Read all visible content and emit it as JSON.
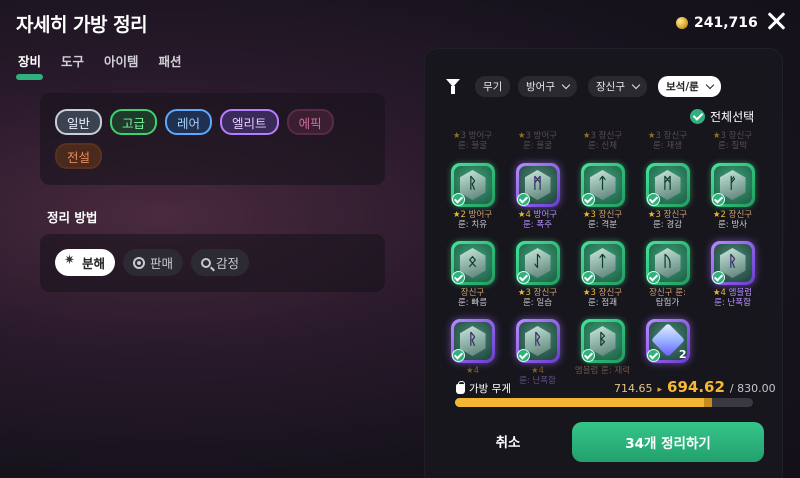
{
  "title": "자세히 가방 정리",
  "gold": "241,716",
  "tabs": [
    {
      "label": "장비",
      "active": true
    },
    {
      "label": "도구",
      "active": false
    },
    {
      "label": "아이템",
      "active": false
    },
    {
      "label": "패션",
      "active": false
    }
  ],
  "grades": {
    "normal": "일반",
    "high": "고급",
    "rare": "레어",
    "elite": "엘리트",
    "epic": "에픽",
    "legend": "전설"
  },
  "method": {
    "title": "정리 방법",
    "dismantle": "분해",
    "sell": "판매",
    "appraise": "감정"
  },
  "filters": {
    "weapon": "무기",
    "armor": "방어구",
    "accessory": "장신구",
    "gem": "보석/룬"
  },
  "select_all": "전체선택",
  "faded_items": [
    {
      "stars": "3",
      "line1": "방어구",
      "line2": "룬: 불굴"
    },
    {
      "stars": "3",
      "line1": "방어구",
      "line2": "룬: 불굴"
    },
    {
      "stars": "3",
      "line1": "장신구",
      "line2": "룬: 신체"
    },
    {
      "stars": "3",
      "line1": "장신구",
      "line2": "룬: 재생"
    },
    {
      "stars": "3",
      "line1": "장신구",
      "line2": "룬: 질박"
    }
  ],
  "items": [
    {
      "frame": "green",
      "glyph": "ᚱ",
      "stars": "2",
      "line1": "방어구",
      "line2": "룬: 치유"
    },
    {
      "frame": "purple",
      "glyph": "ᛗ",
      "stars": "4",
      "line1": "방어구",
      "line2": "룬: 폭주"
    },
    {
      "frame": "green",
      "glyph": "ᛏ",
      "stars": "3",
      "line1": "장신구",
      "line2": "룬: 격분"
    },
    {
      "frame": "green",
      "glyph": "ᛗ",
      "stars": "3",
      "line1": "장신구",
      "line2": "룬: 경감"
    },
    {
      "frame": "green",
      "glyph": "ᚠ",
      "stars": "2",
      "line1": "장신구",
      "line2": "룬: 방사"
    },
    {
      "frame": "green",
      "glyph": "ᛟ",
      "stars": "",
      "line1": "장신구",
      "line2": "룬: 빠름"
    },
    {
      "frame": "green",
      "glyph": "ᛇ",
      "stars": "3",
      "line1": "장신구",
      "line2": "룬: 일습"
    },
    {
      "frame": "green",
      "glyph": "ᛏ",
      "stars": "3",
      "line1": "장신구",
      "line2": "룬: 점괘"
    },
    {
      "frame": "green",
      "glyph": "ᚢ",
      "stars": "",
      "line1": "장신구 룬:",
      "line2": "탐험가"
    },
    {
      "frame": "purple",
      "glyph": "ᚱ",
      "stars": "4",
      "line1": "엠블럼",
      "line2": "룬: 난폭함"
    },
    {
      "frame": "purple",
      "glyph": "ᚱ",
      "stars": "4",
      "line1": "",
      "line2": "",
      "dim": true
    },
    {
      "frame": "purple",
      "glyph": "ᚱ",
      "stars": "4",
      "line1": "",
      "line2": "룬: 난폭함",
      "dim": true
    },
    {
      "frame": "green",
      "glyph": "ᛒ",
      "stars": "",
      "line1": "엠블럼 룬: 재력",
      "line2": "",
      "dim": true
    },
    {
      "frame": "purple",
      "glyph": "",
      "stars": "",
      "line1": "",
      "line2": "",
      "gem": true,
      "count": "2",
      "dim": true
    }
  ],
  "weight": {
    "label": "가방 무게",
    "current": "714.65",
    "after": "694.62",
    "max": "/ 830.00",
    "current_value": 714.65,
    "after_value": 694.62,
    "max_value": 830
  },
  "buttons": {
    "cancel": "취소",
    "confirm": "34개 정리하기"
  },
  "colors": {
    "accent": "#2fb07c",
    "weight": "#f2b635"
  }
}
